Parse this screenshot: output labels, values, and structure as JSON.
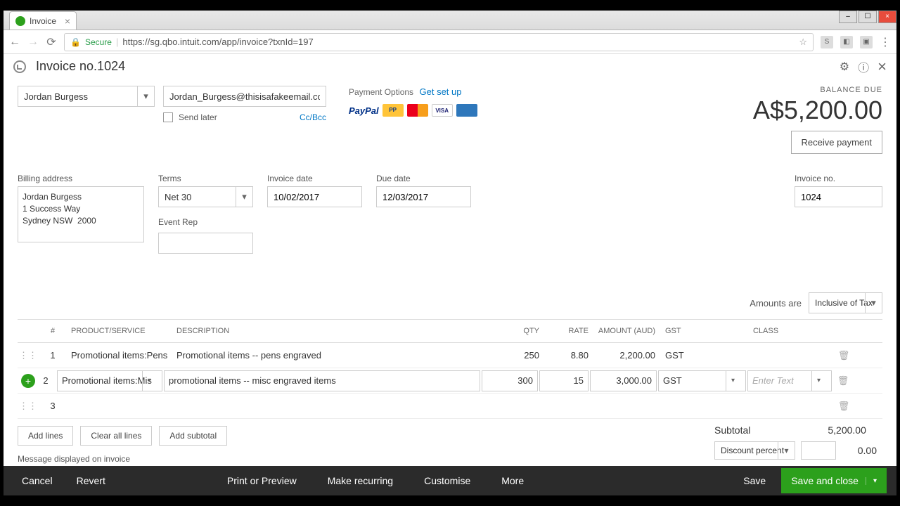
{
  "browser": {
    "tab_title": "Invoice",
    "url": "https://sg.qbo.intuit.com/app/invoice?txnId=197",
    "secure": "Secure"
  },
  "header": {
    "title": "Invoice no.1024"
  },
  "customer": {
    "name": "Jordan Burgess",
    "email": "Jordan_Burgess@thisisafakeemail.com",
    "send_later": "Send later",
    "ccbcc": "Cc/Bcc"
  },
  "payment": {
    "label": "Payment Options",
    "setup": "Get set up",
    "paypal": "PayPal"
  },
  "balance": {
    "label": "BALANCE DUE",
    "amount": "A$5,200.00",
    "receive": "Receive payment"
  },
  "fields": {
    "billing_label": "Billing address",
    "billing_value": "Jordan Burgess\n1 Success Way\nSydney NSW  2000",
    "terms_label": "Terms",
    "terms_value": "Net 30",
    "invdate_label": "Invoice date",
    "invdate_value": "10/02/2017",
    "duedate_label": "Due date",
    "duedate_value": "12/03/2017",
    "invno_label": "Invoice no.",
    "invno_value": "1024",
    "eventrep_label": "Event Rep"
  },
  "amounts_are": {
    "label": "Amounts are",
    "value": "Inclusive of Tax"
  },
  "grid": {
    "headers": {
      "num": "#",
      "prod": "PRODUCT/SERVICE",
      "desc": "DESCRIPTION",
      "qty": "QTY",
      "rate": "RATE",
      "amt": "AMOUNT (AUD)",
      "gst": "GST",
      "class": "CLASS"
    },
    "rows": [
      {
        "num": "1",
        "prod": "Promotional items:Pens",
        "desc": "Promotional items -- pens engraved",
        "qty": "250",
        "rate": "8.80",
        "amt": "2,200.00",
        "gst": "GST",
        "class": ""
      },
      {
        "num": "2",
        "prod": "Promotional items:Mis",
        "desc": "promotional items -- misc engraved items",
        "qty": "300",
        "rate": "15",
        "amt": "3,000.00",
        "gst": "GST",
        "class": "Enter Text"
      },
      {
        "num": "3",
        "prod": "",
        "desc": "",
        "qty": "",
        "rate": "",
        "amt": "",
        "gst": "",
        "class": ""
      }
    ]
  },
  "lines": {
    "add": "Add lines",
    "clear": "Clear all lines",
    "subtotal_btn": "Add subtotal"
  },
  "totals": {
    "subtotal_label": "Subtotal",
    "subtotal_value": "5,200.00",
    "discount_label": "Discount percent",
    "discount_value": "0.00"
  },
  "message": {
    "label": "Message displayed on invoice"
  },
  "footer": {
    "cancel": "Cancel",
    "revert": "Revert",
    "print": "Print or Preview",
    "recurring": "Make recurring",
    "customise": "Customise",
    "more": "More",
    "save": "Save",
    "save_close": "Save and close"
  }
}
